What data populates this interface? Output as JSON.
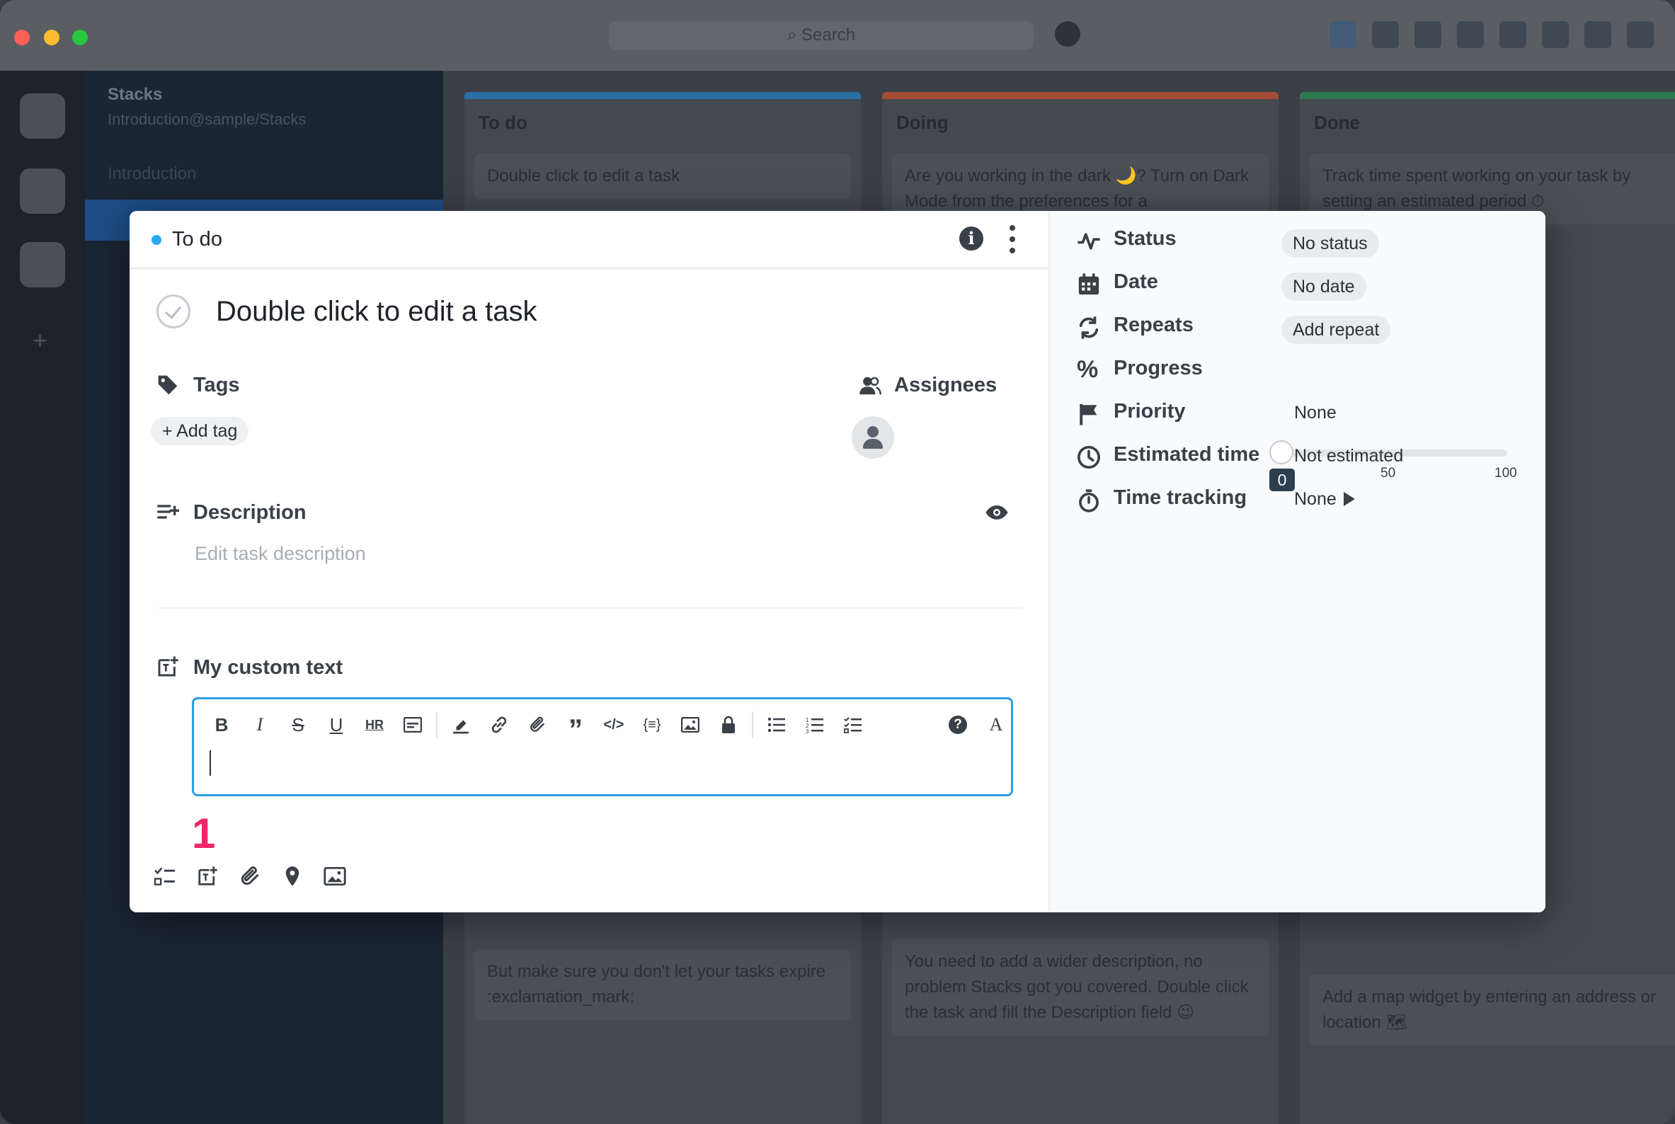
{
  "window": {
    "search_placeholder": "Search",
    "toolbar_icons": [
      "board-view-icon",
      "list-view-icon",
      "calendar-icon",
      "calendar-week-icon",
      "emoji-icon",
      "map-pin-icon",
      "bag-icon",
      "sidebar-toggle-icon"
    ]
  },
  "sidebar": {
    "title": "Stacks",
    "subtitle": "Introduction@sample/Stacks",
    "items": [
      {
        "label": "Introduction"
      }
    ]
  },
  "board": {
    "columns": [
      {
        "title": "To do",
        "color": "#2aa8f2",
        "cards": [
          "Double click to edit a task",
          "But make sure you don't let your tasks expire :exclamation_mark:"
        ]
      },
      {
        "title": "Doing",
        "color": "#e8573c",
        "cards": [
          "Are you working in the dark 🌙? Turn on Dark Mode from the preferences for a",
          "You need to add a wider description, no problem Stacks got you covered. Double click the task and fill the Description field 😉"
        ]
      },
      {
        "title": "Done",
        "color": "#2fb36b",
        "cards": [
          "Track time spent working on your task by setting an estimated period ⏱",
          "Add a map widget by entering an address or location 🗺"
        ]
      }
    ]
  },
  "modal": {
    "column_name": "To do",
    "column_color": "#2aa8f2",
    "task_title": "Double click to edit a task",
    "tags": {
      "label": "Tags",
      "add_label": "+ Add tag"
    },
    "assignees": {
      "label": "Assignees"
    },
    "description": {
      "label": "Description",
      "placeholder": "Edit task description"
    },
    "custom_field": {
      "label": "My custom text"
    },
    "editor_toolbar": [
      "bold-icon",
      "italic-icon",
      "strikethrough-icon",
      "underline-icon",
      "hr-icon",
      "preview-icon",
      "highlight-icon",
      "link-icon",
      "attachment-icon",
      "quote-icon",
      "code-icon",
      "codeblock-icon",
      "image-icon",
      "lock-icon",
      "bullet-list-icon",
      "numbered-list-icon",
      "checklist-icon",
      "help-icon",
      "font-icon"
    ],
    "annotation_badge": "1",
    "properties": {
      "status": {
        "label": "Status",
        "value": "No status"
      },
      "date": {
        "label": "Date",
        "value": "No date"
      },
      "repeats": {
        "label": "Repeats",
        "value": "Add repeat"
      },
      "progress": {
        "label": "Progress",
        "value": "0",
        "tick_mid": "50",
        "tick_max": "100",
        "fraction": 0
      },
      "priority": {
        "label": "Priority",
        "value": "None"
      },
      "estimated_time": {
        "label": "Estimated time",
        "value": "Not estimated"
      },
      "time_tracking": {
        "label": "Time tracking",
        "value": "None"
      }
    }
  }
}
